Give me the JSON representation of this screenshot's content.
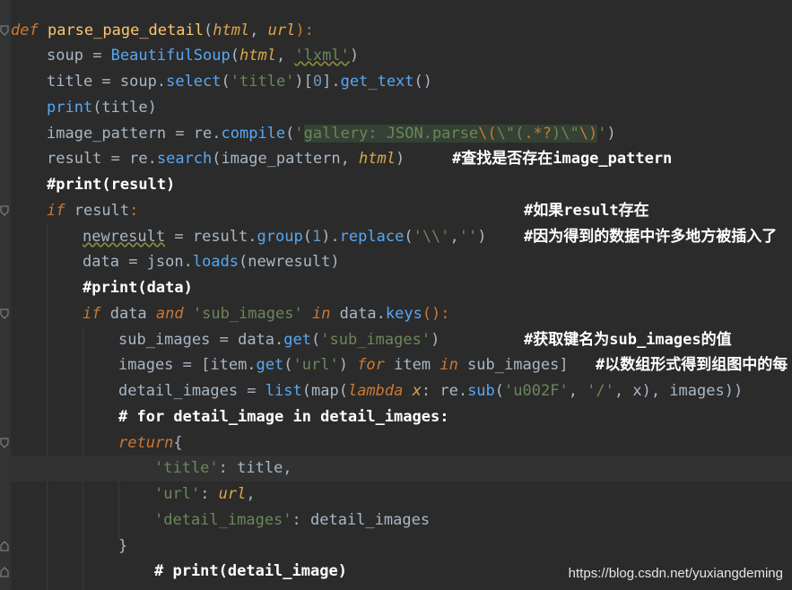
{
  "code": {
    "l1": {
      "kw": "def",
      "name": "parse_page_detail",
      "open": "(",
      "p1": "html",
      "comma": ", ",
      "p2": "url",
      "close": "):"
    },
    "l2": {
      "var": "soup",
      "eq": " = ",
      "call": "BeautifulSoup",
      "open": "(",
      "arg": "html",
      "comma": ", ",
      "str": "'lxml'",
      "close": ")"
    },
    "l3": {
      "var": "title",
      "eq": " = ",
      "obj": "soup.",
      "call": "select",
      "open": "(",
      "str": "'title'",
      "mid": ")[",
      "num": "0",
      "dot": "].",
      "call2": "get_text",
      "close": "()"
    },
    "l4": {
      "call": "print",
      "rest": "(title)"
    },
    "l5": {
      "var": "image_pattern",
      "eq": " = ",
      "obj": "re.",
      "call": "compile",
      "open": "(",
      "q1": "'",
      "s1": "gallery: JSON.parse",
      "e1": "\\(",
      "s2": "\\\"(",
      "e2": ".*?",
      "s3": ")\\\"",
      "e3": "\\)",
      "q2": "'",
      "close": ")"
    },
    "l6": {
      "var": "result",
      "eq": " = ",
      "obj": "re.",
      "call": "search",
      "open": "(image_pattern, ",
      "arg": "html",
      "close": ")",
      "comment": "#查找是否存在image_pattern"
    },
    "l7": {
      "comment": "#print(result)"
    },
    "l8": {
      "kw": "if",
      "rest": " result",
      "colon": ":",
      "comment": "#如果result存在"
    },
    "l9": {
      "var": "newresult",
      "eq": " = ",
      "obj": "result.",
      "call": "group",
      "open": "(",
      "num": "1",
      "mid": ").",
      "call2": "replace",
      "open2": "(",
      "str1": "'\\\\'",
      "comma": ",",
      "str2": "''",
      "close": ")",
      "comment": "#因为得到的数据中许多地方被插入了"
    },
    "l10": {
      "var": "data",
      "eq": " = ",
      "obj": "json.",
      "call": "loads",
      "rest": "(newresult)"
    },
    "l11": {
      "comment": "#print(data)"
    },
    "l12": {
      "kw": "if",
      "mid1": " data ",
      "kw2": "and",
      "sp": " ",
      "str": "'sub_images'",
      "sp2": " ",
      "kw3": "in",
      "mid2": " data.",
      "call": "keys",
      "close": "():"
    },
    "l13": {
      "var": "sub_images",
      "eq": " = ",
      "obj": "data.",
      "call": "get",
      "open": "(",
      "str": "'sub_images'",
      "close": ")",
      "comment": "#获取键名为sub_images的值"
    },
    "l14": {
      "var": "images",
      "eq": " = [item.",
      "call": "get",
      "open": "(",
      "str": "'url'",
      "close": ") ",
      "kw": "for",
      "mid": " item ",
      "kw2": "in",
      "rest": " sub_images]",
      "comment": "#以数组形式得到组图中的每"
    },
    "l15": {
      "var": "detail_images",
      "eq": " = ",
      "call": "list",
      "open": "(",
      "call2": "map",
      "open2": "(",
      "kw": "lambda",
      "sp": " ",
      "p": "x",
      "colon": ": re.",
      "call3": "sub",
      "open3": "(",
      "str1": "'u002F'",
      "comma": ", ",
      "str2": "'/'",
      "close": ", x), images))"
    },
    "l16": {
      "comment": "# for detail_image in detail_images:"
    },
    "l17": {
      "kw": "return",
      "brace": "{"
    },
    "l18": {
      "str": "'title'",
      "rest": ": title,"
    },
    "l19": {
      "str": "'url'",
      "colon": ": ",
      "p": "url",
      "comma": ","
    },
    "l20": {
      "str": "'detail_images'",
      "rest": ": detail_images"
    },
    "l21": {
      "brace": "}"
    },
    "l22": {
      "comment": "# print(detail_image)"
    }
  },
  "watermark": "https://blog.csdn.net/yuxiangdeming",
  "colors": {
    "background": "#2b2b2b",
    "keyword": "#cc7832",
    "string": "#6a8759",
    "function": "#ffc66d",
    "comment": "#ffffff"
  }
}
